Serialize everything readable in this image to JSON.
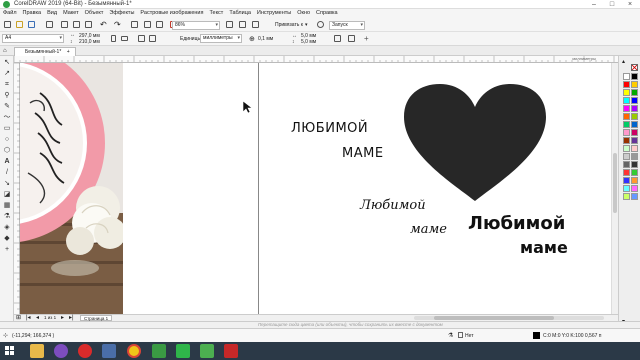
{
  "window": {
    "title": "CorelDRAW 2019 (64-Bit) - Безымянный-1*"
  },
  "menubar": {
    "items": [
      "Файл",
      "Правка",
      "Вид",
      "Макет",
      "Объект",
      "Эффекты",
      "Растровые изображения",
      "Текст",
      "Таблица",
      "Инструменты",
      "Окно",
      "Справка"
    ]
  },
  "toolbar1": {
    "zoom": "86%",
    "snap": "Привязать к",
    "launch": "Запуск"
  },
  "toolbar2": {
    "page_size": "A4",
    "width": "297,0 мм",
    "height": "210,0 мм",
    "units_label": "Единицы:",
    "units": "миллиметры",
    "nudge": "0,1 мм",
    "dup_x": "5,0 мм",
    "dup_y": "5,0 мм"
  },
  "doc_tab": {
    "label": "Безымянный-1*"
  },
  "ruler": {
    "units_label": "миллиметры"
  },
  "canvas": {
    "text1_line1": "ЛЮБИМОЙ",
    "text1_line2": "МАМЕ",
    "text2_line1": "Любимой",
    "text2_line2": "маме",
    "text3_line1": "Любимой",
    "text3_line2": "маме"
  },
  "pagebar": {
    "page_counter": "1 из 1",
    "page_tab": "Страница 1"
  },
  "statusbar": {
    "coords": "(-11,294; 166,374 )",
    "hint": "Перетащите сюда цвета (или объекты), чтобы сохранить их вместе с документом",
    "fill_none": "Нет",
    "outline": "C:0 M:0 Y:0 K:100   0,567 п"
  },
  "colors": {
    "accent": "#1a1a1a",
    "taskbar": "#2b3947",
    "photo_frame": "#f29aa8"
  },
  "palette": [
    "#ffffff",
    "#000000",
    "#ff0000",
    "#ffcc00",
    "#ffff00",
    "#00aa00",
    "#00ffff",
    "#0000ff",
    "#ff00ff",
    "#aa00ff",
    "#ff6600",
    "#99cc00",
    "#00cc66",
    "#0066cc",
    "#ff99cc",
    "#cc0066",
    "#993300",
    "#663399",
    "#ccffcc",
    "#ffcccc",
    "#cccccc",
    "#999999",
    "#666666",
    "#333333",
    "#ff3333",
    "#33cc33",
    "#3333ff",
    "#ff9933",
    "#66ffff",
    "#ff66ff",
    "#ccff66",
    "#6699ff"
  ],
  "taskbar_icons": [
    "start-icon",
    "explorer-icon",
    "viber-icon",
    "opera-icon",
    "media-icon",
    "chrome-icon",
    "coreldraw-icon",
    "corel-capture-icon",
    "green-app-icon",
    "pdf-icon"
  ]
}
